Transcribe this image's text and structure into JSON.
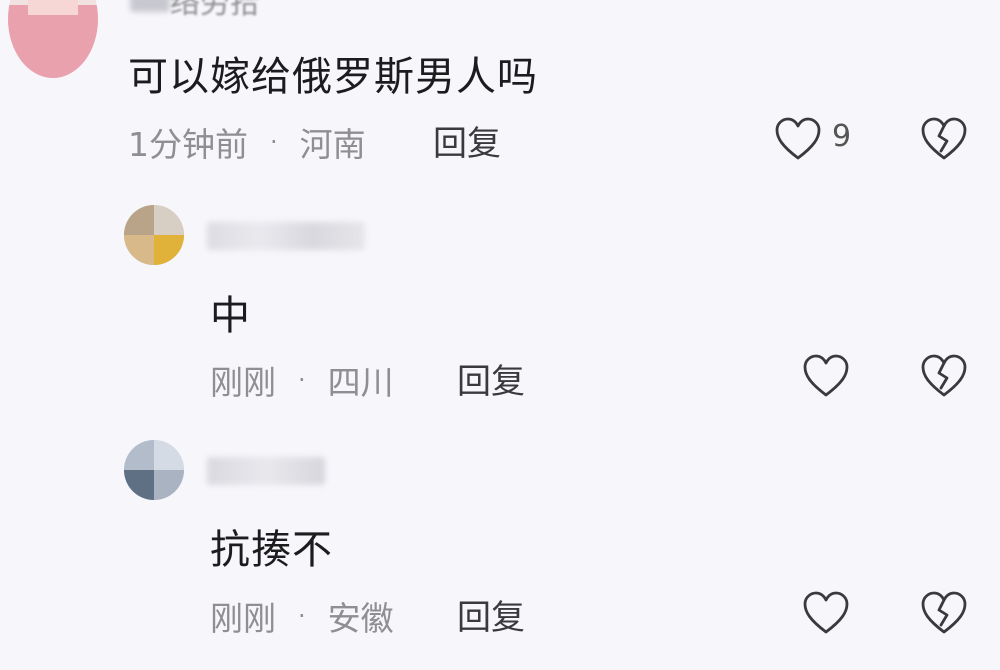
{
  "comments": [
    {
      "username_partial": "络劳拾",
      "text": "可以嫁给俄罗斯男人吗",
      "time": "1分钟前",
      "location": "河南",
      "reply_label": "回复",
      "like_count": "9"
    },
    {
      "text": "中",
      "time": "刚刚",
      "location": "四川",
      "reply_label": "回复"
    },
    {
      "text": "抗揍不",
      "time": "刚刚",
      "location": "安徽",
      "reply_label": "回复"
    }
  ],
  "separator": "·",
  "icons": {
    "like": "heart-outline-icon",
    "dislike": "broken-heart-icon"
  }
}
